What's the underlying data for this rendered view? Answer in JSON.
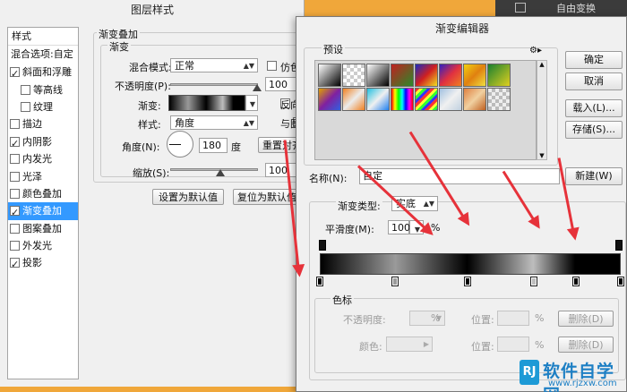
{
  "background": {
    "color": "#f0a73a"
  },
  "ps_top": {
    "menu_item": "自由变换"
  },
  "layer_style": {
    "title": "图层样式",
    "styles_header": "样式",
    "blend_options": "混合选项:自定",
    "items": [
      {
        "label": "斜面和浮雕",
        "checked": true
      },
      {
        "label": "等高线",
        "checked": false
      },
      {
        "label": "纹理",
        "checked": false
      },
      {
        "label": "描边",
        "checked": false
      },
      {
        "label": "内阴影",
        "checked": true
      },
      {
        "label": "内发光",
        "checked": false
      },
      {
        "label": "光泽",
        "checked": false
      },
      {
        "label": "颜色叠加",
        "checked": false
      },
      {
        "label": "渐变叠加",
        "checked": true,
        "selected": true
      },
      {
        "label": "图案叠加",
        "checked": false
      },
      {
        "label": "外发光",
        "checked": false
      },
      {
        "label": "投影",
        "checked": true
      }
    ],
    "section_title": "渐变叠加",
    "sub_title": "渐变",
    "blend_mode_label": "混合模式:",
    "blend_mode_value": "正常",
    "simulate_label": "仿色",
    "opacity_label": "不透明度(P):",
    "opacity_value": "100",
    "gradient_label": "渐变:",
    "reverse_label": "反向",
    "style_label": "样式:",
    "style_value": "角度",
    "align_label": "与图",
    "angle_label": "角度(N):",
    "angle_value": "180",
    "angle_unit": "度",
    "reset_align_button": "重置对齐",
    "scale_label": "缩放(S):",
    "scale_value": "100",
    "set_default_button": "设置为默认值",
    "reset_default_button": "复位为默认值"
  },
  "gradient_editor": {
    "title": "渐变编辑器",
    "presets_label": "预设",
    "ok_button": "确定",
    "cancel_button": "取消",
    "load_button": "载入(L)...",
    "save_button": "存储(S)...",
    "name_label": "名称(N):",
    "name_value": "自定",
    "new_button": "新建(W)",
    "type_label": "渐变类型:",
    "type_value": "实底",
    "smooth_label": "平滑度(M):",
    "smooth_value": "100",
    "smooth_unit": "%",
    "color_stop_label": "色标",
    "opacity_label": "不透明度:",
    "percent": "%",
    "location_label": "位置:",
    "delete_button": "删除(D)",
    "color_label": "颜色:",
    "gradient_stops": [
      {
        "pos": 0,
        "color": "#000000"
      },
      {
        "pos": 0.25,
        "color": "#9a9a9a"
      },
      {
        "pos": 0.49,
        "color": "#000000"
      },
      {
        "pos": 0.71,
        "color": "#bdbdbd"
      },
      {
        "pos": 0.85,
        "color": "#000000"
      },
      {
        "pos": 1,
        "color": "#000000"
      }
    ]
  },
  "watermark": {
    "main": "软件自学网",
    "url": "www.rjzxw.com"
  }
}
